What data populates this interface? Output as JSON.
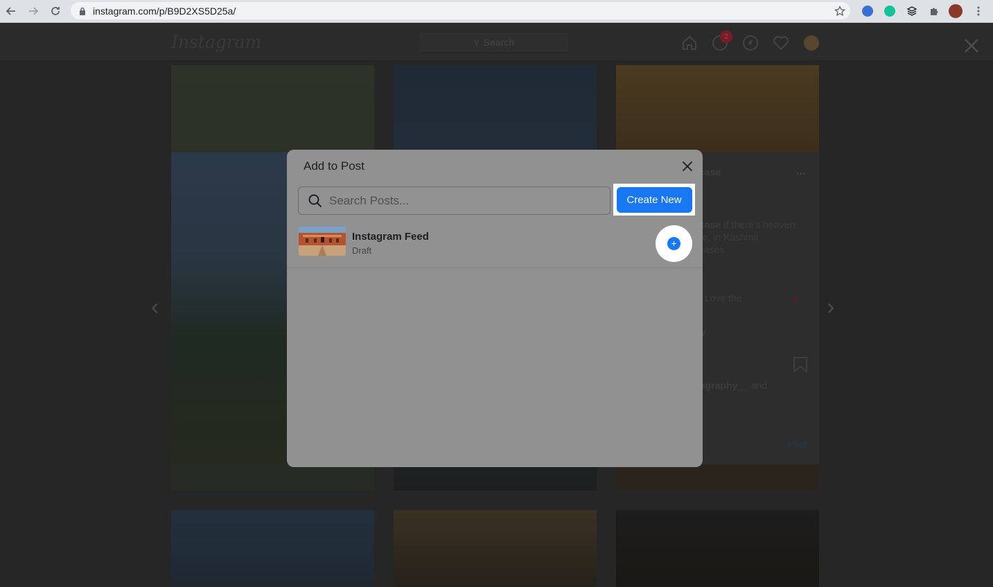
{
  "browser": {
    "url": "instagram.com/p/B9D2XS5D25a/"
  },
  "instagram": {
    "logo": "Instagram",
    "search_placeholder": "Search",
    "messages_badge": "2",
    "post_panel": {
      "username_fragment": "case",
      "caption_line1_bold": "case",
      "caption_line1": " If there's heaven",
      "caption_line2": "re, in Kashmir.",
      "caption_line3": "cases",
      "comment_fragment": "Love the",
      "reply_fragment": "ly",
      "likes_bold": "ography__",
      "likes_rest": " and",
      "post_button": "Post"
    }
  },
  "modal": {
    "title": "Add to Post",
    "search_placeholder": "Search Posts...",
    "create_button": "Create New",
    "items": [
      {
        "title": "Instagram Feed",
        "status": "Draft"
      }
    ]
  },
  "colors": {
    "accent": "#1877f2",
    "overlay": "#272727",
    "modal_bg": "#919191"
  }
}
